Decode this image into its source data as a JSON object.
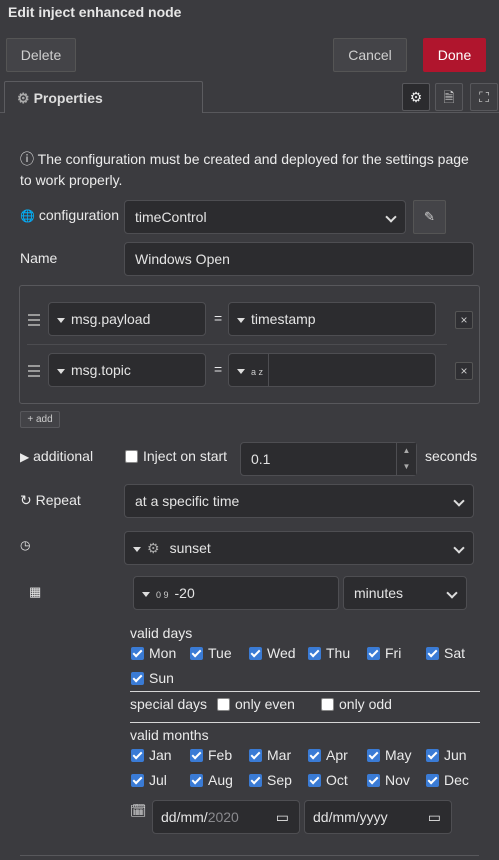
{
  "window": {
    "title": "Edit inject enhanced node"
  },
  "toolbar": {
    "delete_label": "Delete",
    "cancel_label": "Cancel",
    "done_label": "Done"
  },
  "tabs": {
    "properties_label": "Properties"
  },
  "info": {
    "text": "The configuration must be created and deployed for the settings page to work properly."
  },
  "form": {
    "configuration_label": "configuration",
    "configuration_value": "timeControl",
    "name_label": "Name",
    "name_value": "Windows Open",
    "props": [
      {
        "prop": "msg.payload",
        "eq": "=",
        "value": "timestamp"
      },
      {
        "prop": "msg.topic",
        "eq": "=",
        "type_icon": "a z",
        "value": ""
      }
    ],
    "add_label": "add",
    "additional_label": "additional",
    "inject_on_start_label": "Inject on start",
    "inject_delay": "0.1",
    "seconds_label": "seconds",
    "repeat_label": "Repeat",
    "repeat_value": "at a specific time",
    "time_value": "sunset",
    "offset_type_icon": "0 9",
    "offset_value": "-20",
    "offset_unit": "minutes",
    "valid_days_label": "valid days",
    "days": [
      "Mon",
      "Tue",
      "Wed",
      "Thu",
      "Fri",
      "Sat",
      "Sun"
    ],
    "special_days_label": "special days",
    "only_even_label": "only even",
    "only_odd_label": "only odd",
    "valid_months_label": "valid months",
    "months": [
      "Jan",
      "Feb",
      "Mar",
      "Apr",
      "May",
      "Jun",
      "Jul",
      "Aug",
      "Sep",
      "Oct",
      "Nov",
      "Dec"
    ],
    "date_start_prefix": "dd/mm/",
    "date_start_year": "2020",
    "date_end": "dd/mm/yyyy"
  },
  "colors": {
    "accent": "#b0152d",
    "checkbox": "#3a7bd5",
    "background": "#3b3b3f"
  }
}
